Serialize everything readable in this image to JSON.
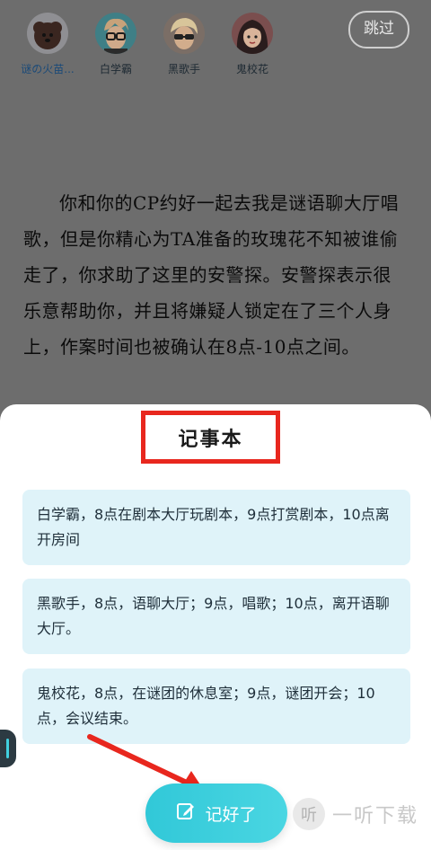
{
  "header": {
    "skip_label": "跳过",
    "characters": [
      {
        "name": "谜の火苗...",
        "icon": "avatar-dog"
      },
      {
        "name": "白学霸",
        "icon": "avatar-glasses-boy"
      },
      {
        "name": "黑歌手",
        "icon": "avatar-singer"
      },
      {
        "name": "鬼校花",
        "icon": "avatar-girl"
      }
    ]
  },
  "story": {
    "text": "你和你的CP约好一起去我是谜语聊大厅唱歌，但是你精心为TA准备的玫瑰花不知被谁偷走了，你求助了这里的安警探。安警探表示很乐意帮助你，并且将嫌疑人锁定在了三个人身上，作案时间也被确认在8点-10点之间。"
  },
  "notebook": {
    "title": "记事本",
    "notes": [
      "白学霸，8点在剧本大厅玩剧本，9点打赏剧本，10点离开房间",
      "黑歌手，8点，语聊大厅；9点，唱歌；10点，离开语聊大厅。",
      "鬼校花，8点，在谜团的休息室；9点，谜团开会；10点，会议结束。"
    ],
    "confirm_label": "记好了"
  },
  "watermark": {
    "logo_text": "听",
    "text": "一听下载"
  },
  "colors": {
    "accent": "#3ccfe0",
    "highlight": "#e8271e",
    "note_bg": "#dff3f9"
  }
}
